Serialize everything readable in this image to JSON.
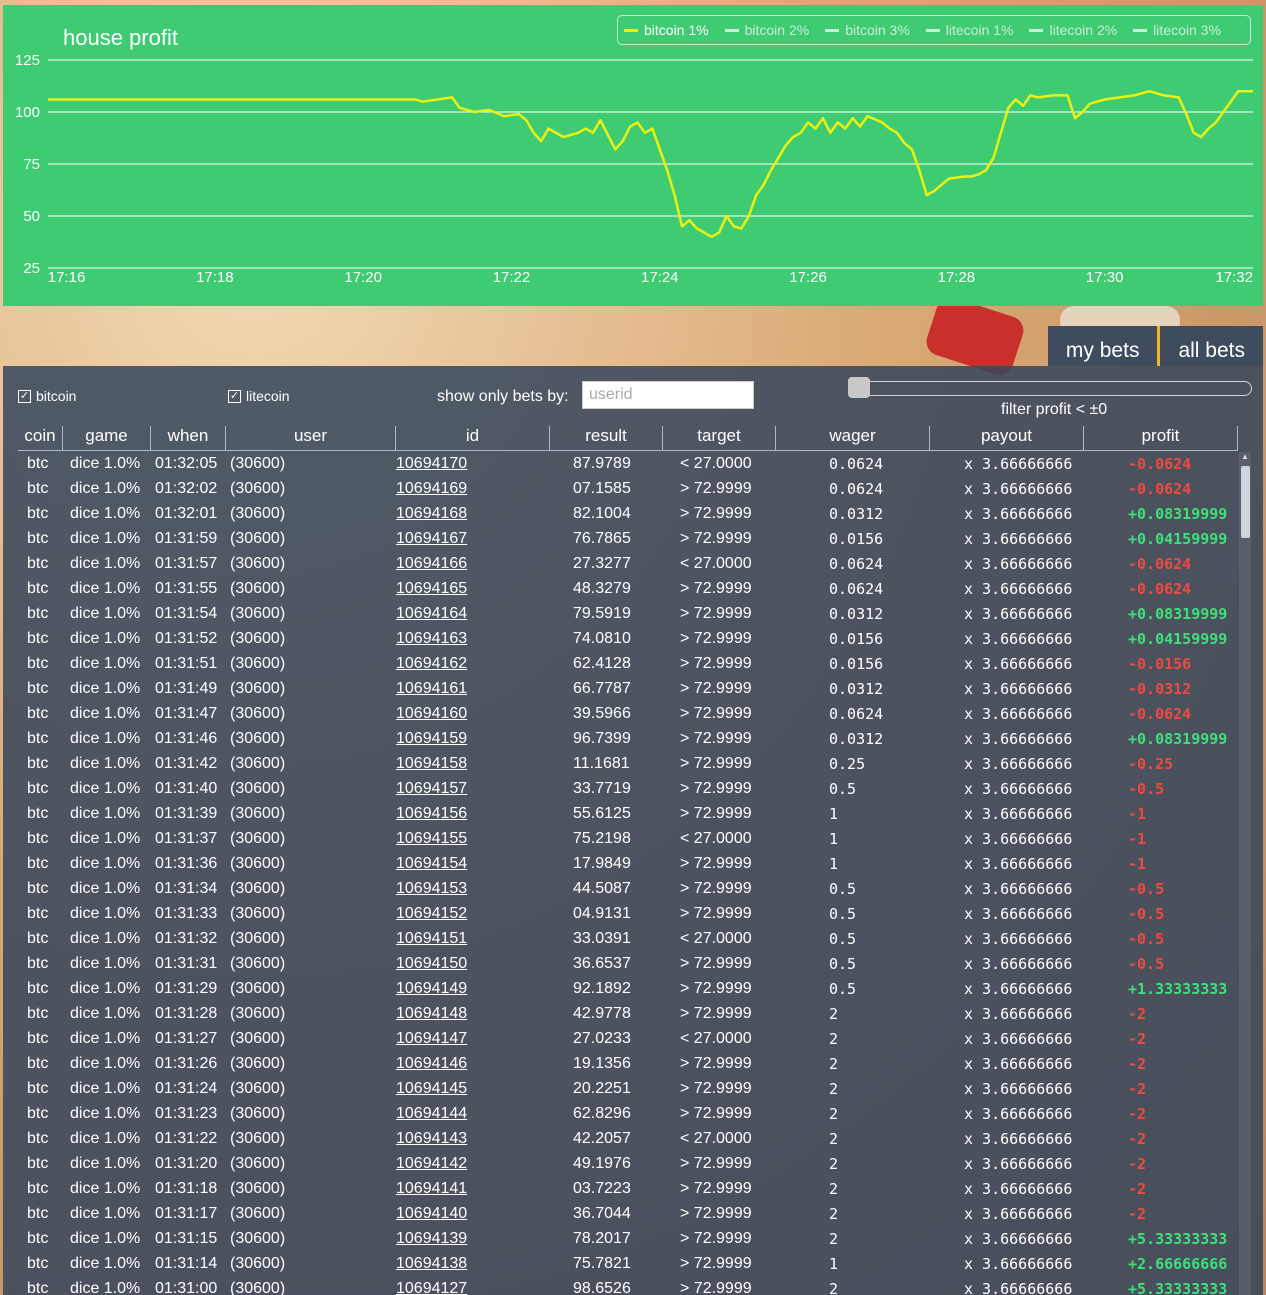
{
  "chart_data": {
    "type": "line",
    "title": "house profit",
    "legend": [
      "bitcoin 1%",
      "bitcoin 2%",
      "bitcoin 3%",
      "litecoin 1%",
      "litecoin 2%",
      "litecoin 3%"
    ],
    "legend_active": "bitcoin 1%",
    "legend_placement": "top-right",
    "grid": true,
    "ylim": [
      25,
      125
    ],
    "yticks": [
      25,
      50,
      75,
      100,
      125
    ],
    "xticks": [
      "17:16",
      "17:18",
      "17:20",
      "17:22",
      "17:24",
      "17:26",
      "17:28",
      "17:30",
      "17:32"
    ],
    "xlim_minutes": [
      15.75,
      32
    ],
    "colors": {
      "line": "#e8f213",
      "background": "#3fcb72"
    },
    "series": [
      {
        "name": "bitcoin 1%",
        "points": [
          [
            15.75,
            106
          ],
          [
            17,
            106
          ],
          [
            18,
            106
          ],
          [
            19,
            106
          ],
          [
            20,
            106
          ],
          [
            20.7,
            106
          ],
          [
            20.8,
            105
          ],
          [
            21,
            106
          ],
          [
            21.2,
            107
          ],
          [
            21.3,
            102
          ],
          [
            21.5,
            100
          ],
          [
            21.7,
            101
          ],
          [
            21.9,
            98
          ],
          [
            22.1,
            99
          ],
          [
            22.2,
            96
          ],
          [
            22.3,
            90
          ],
          [
            22.4,
            86
          ],
          [
            22.5,
            92
          ],
          [
            22.7,
            88
          ],
          [
            22.9,
            90
          ],
          [
            23,
            92
          ],
          [
            23.1,
            90
          ],
          [
            23.2,
            96
          ],
          [
            23.3,
            89
          ],
          [
            23.4,
            82
          ],
          [
            23.5,
            86
          ],
          [
            23.6,
            93
          ],
          [
            23.7,
            95
          ],
          [
            23.8,
            90
          ],
          [
            23.9,
            92
          ],
          [
            24,
            82
          ],
          [
            24.1,
            72
          ],
          [
            24.2,
            60
          ],
          [
            24.3,
            45
          ],
          [
            24.4,
            48
          ],
          [
            24.5,
            44
          ],
          [
            24.6,
            42
          ],
          [
            24.7,
            40
          ],
          [
            24.8,
            42
          ],
          [
            24.9,
            50
          ],
          [
            25,
            45
          ],
          [
            25.1,
            44
          ],
          [
            25.2,
            50
          ],
          [
            25.3,
            60
          ],
          [
            25.4,
            65
          ],
          [
            25.5,
            72
          ],
          [
            25.6,
            78
          ],
          [
            25.7,
            84
          ],
          [
            25.8,
            88
          ],
          [
            25.9,
            90
          ],
          [
            26,
            95
          ],
          [
            26.1,
            92
          ],
          [
            26.2,
            97
          ],
          [
            26.3,
            90
          ],
          [
            26.4,
            95
          ],
          [
            26.5,
            92
          ],
          [
            26.6,
            97
          ],
          [
            26.7,
            93
          ],
          [
            26.8,
            98
          ],
          [
            27,
            95
          ],
          [
            27.1,
            92
          ],
          [
            27.2,
            90
          ],
          [
            27.3,
            85
          ],
          [
            27.4,
            82
          ],
          [
            27.5,
            72
          ],
          [
            27.6,
            60
          ],
          [
            27.7,
            62
          ],
          [
            27.9,
            68
          ],
          [
            28.1,
            69
          ],
          [
            28.2,
            69
          ],
          [
            28.3,
            70
          ],
          [
            28.4,
            72
          ],
          [
            28.5,
            78
          ],
          [
            28.6,
            90
          ],
          [
            28.7,
            102
          ],
          [
            28.8,
            106
          ],
          [
            28.9,
            103
          ],
          [
            29,
            108
          ],
          [
            29.1,
            107
          ],
          [
            29.3,
            108
          ],
          [
            29.5,
            108
          ],
          [
            29.6,
            97
          ],
          [
            29.7,
            100
          ],
          [
            29.8,
            104
          ],
          [
            30,
            106
          ],
          [
            30.2,
            107
          ],
          [
            30.4,
            108
          ],
          [
            30.6,
            110
          ],
          [
            30.8,
            108
          ],
          [
            31,
            107
          ],
          [
            31.1,
            99
          ],
          [
            31.2,
            90
          ],
          [
            31.3,
            88
          ],
          [
            31.4,
            92
          ],
          [
            31.5,
            95
          ],
          [
            31.6,
            100
          ],
          [
            31.7,
            105
          ],
          [
            31.8,
            110
          ],
          [
            32,
            110
          ]
        ]
      }
    ]
  },
  "tabs": [
    {
      "label": "my bets"
    },
    {
      "label": "all bets"
    }
  ],
  "filters": {
    "bitcoin": {
      "label": "bitcoin",
      "checked": true
    },
    "litecoin": {
      "label": "litecoin",
      "checked": true
    },
    "show_only_label": "show only bets by:",
    "userid_placeholder": "userid",
    "profit_filter_label": "filter profit < ±0",
    "slider_value_fraction": 0
  },
  "table": {
    "columns": [
      "coin",
      "game",
      "when",
      "user",
      "id",
      "result",
      "target",
      "wager",
      "payout",
      "profit"
    ],
    "rows": [
      [
        "btc",
        "dice 1.0%",
        "01:32:05",
        "(30600)",
        "10694170",
        "87.9789",
        "red",
        "< 27.0000",
        "0.0624",
        "x 3.66666666",
        "-0.0624"
      ],
      [
        "btc",
        "dice 1.0%",
        "01:32:02",
        "(30600)",
        "10694169",
        "07.1585",
        "red",
        "> 72.9999",
        "0.0624",
        "x 3.66666666",
        "-0.0624"
      ],
      [
        "btc",
        "dice 1.0%",
        "01:32:01",
        "(30600)",
        "10694168",
        "82.1004",
        "green",
        "> 72.9999",
        "0.0312",
        "x 3.66666666",
        "+0.08319999"
      ],
      [
        "btc",
        "dice 1.0%",
        "01:31:59",
        "(30600)",
        "10694167",
        "76.7865",
        "green",
        "> 72.9999",
        "0.0156",
        "x 3.66666666",
        "+0.04159999"
      ],
      [
        "btc",
        "dice 1.0%",
        "01:31:57",
        "(30600)",
        "10694166",
        "27.3277",
        "gray",
        "< 27.0000",
        "0.0624",
        "x 3.66666666",
        "-0.0624"
      ],
      [
        "btc",
        "dice 1.0%",
        "01:31:55",
        "(30600)",
        "10694165",
        "48.3279",
        "gray",
        "> 72.9999",
        "0.0624",
        "x 3.66666666",
        "-0.0624"
      ],
      [
        "btc",
        "dice 1.0%",
        "01:31:54",
        "(30600)",
        "10694164",
        "79.5919",
        "green",
        "> 72.9999",
        "0.0312",
        "x 3.66666666",
        "+0.08319999"
      ],
      [
        "btc",
        "dice 1.0%",
        "01:31:52",
        "(30600)",
        "10694163",
        "74.0810",
        "green",
        "> 72.9999",
        "0.0156",
        "x 3.66666666",
        "+0.04159999"
      ],
      [
        "btc",
        "dice 1.0%",
        "01:31:51",
        "(30600)",
        "10694162",
        "62.4128",
        "gray",
        "> 72.9999",
        "0.0156",
        "x 3.66666666",
        "-0.0156"
      ],
      [
        "btc",
        "dice 1.0%",
        "01:31:49",
        "(30600)",
        "10694161",
        "66.7787",
        "gray",
        "> 72.9999",
        "0.0312",
        "x 3.66666666",
        "-0.0312"
      ],
      [
        "btc",
        "dice 1.0%",
        "01:31:47",
        "(30600)",
        "10694160",
        "39.5966",
        "gray",
        "> 72.9999",
        "0.0624",
        "x 3.66666666",
        "-0.0624"
      ],
      [
        "btc",
        "dice 1.0%",
        "01:31:46",
        "(30600)",
        "10694159",
        "96.7399",
        "green",
        "> 72.9999",
        "0.0312",
        "x 3.66666666",
        "+0.08319999"
      ],
      [
        "btc",
        "dice 1.0%",
        "01:31:42",
        "(30600)",
        "10694158",
        "11.1681",
        "red",
        "> 72.9999",
        "0.25",
        "x 3.66666666",
        "-0.25"
      ],
      [
        "btc",
        "dice 1.0%",
        "01:31:40",
        "(30600)",
        "10694157",
        "33.7719",
        "gray",
        "> 72.9999",
        "0.5",
        "x 3.66666666",
        "-0.5"
      ],
      [
        "btc",
        "dice 1.0%",
        "01:31:39",
        "(30600)",
        "10694156",
        "55.6125",
        "gray",
        "> 72.9999",
        "1",
        "x 3.66666666",
        "-1"
      ],
      [
        "btc",
        "dice 1.0%",
        "01:31:37",
        "(30600)",
        "10694155",
        "75.2198",
        "red",
        "< 27.0000",
        "1",
        "x 3.66666666",
        "-1"
      ],
      [
        "btc",
        "dice 1.0%",
        "01:31:36",
        "(30600)",
        "10694154",
        "17.9849",
        "red",
        "> 72.9999",
        "1",
        "x 3.66666666",
        "-1"
      ],
      [
        "btc",
        "dice 1.0%",
        "01:31:34",
        "(30600)",
        "10694153",
        "44.5087",
        "gray",
        "> 72.9999",
        "0.5",
        "x 3.66666666",
        "-0.5"
      ],
      [
        "btc",
        "dice 1.0%",
        "01:31:33",
        "(30600)",
        "10694152",
        "04.9131",
        "red",
        "> 72.9999",
        "0.5",
        "x 3.66666666",
        "-0.5"
      ],
      [
        "btc",
        "dice 1.0%",
        "01:31:32",
        "(30600)",
        "10694151",
        "33.0391",
        "gray",
        "< 27.0000",
        "0.5",
        "x 3.66666666",
        "-0.5"
      ],
      [
        "btc",
        "dice 1.0%",
        "01:31:31",
        "(30600)",
        "10694150",
        "36.6537",
        "gray",
        "> 72.9999",
        "0.5",
        "x 3.66666666",
        "-0.5"
      ],
      [
        "btc",
        "dice 1.0%",
        "01:31:29",
        "(30600)",
        "10694149",
        "92.1892",
        "green",
        "> 72.9999",
        "0.5",
        "x 3.66666666",
        "+1.33333333"
      ],
      [
        "btc",
        "dice 1.0%",
        "01:31:28",
        "(30600)",
        "10694148",
        "42.9778",
        "gray",
        "> 72.9999",
        "2",
        "x 3.66666666",
        "-2"
      ],
      [
        "btc",
        "dice 1.0%",
        "01:31:27",
        "(30600)",
        "10694147",
        "27.0233",
        "gray",
        "< 27.0000",
        "2",
        "x 3.66666666",
        "-2"
      ],
      [
        "btc",
        "dice 1.0%",
        "01:31:26",
        "(30600)",
        "10694146",
        "19.1356",
        "red",
        "> 72.9999",
        "2",
        "x 3.66666666",
        "-2"
      ],
      [
        "btc",
        "dice 1.0%",
        "01:31:24",
        "(30600)",
        "10694145",
        "20.2251",
        "red",
        "> 72.9999",
        "2",
        "x 3.66666666",
        "-2"
      ],
      [
        "btc",
        "dice 1.0%",
        "01:31:23",
        "(30600)",
        "10694144",
        "62.8296",
        "gray",
        "> 72.9999",
        "2",
        "x 3.66666666",
        "-2"
      ],
      [
        "btc",
        "dice 1.0%",
        "01:31:22",
        "(30600)",
        "10694143",
        "42.2057",
        "gray",
        "< 27.0000",
        "2",
        "x 3.66666666",
        "-2"
      ],
      [
        "btc",
        "dice 1.0%",
        "01:31:20",
        "(30600)",
        "10694142",
        "49.1976",
        "gray",
        "> 72.9999",
        "2",
        "x 3.66666666",
        "-2"
      ],
      [
        "btc",
        "dice 1.0%",
        "01:31:18",
        "(30600)",
        "10694141",
        "03.7223",
        "red",
        "> 72.9999",
        "2",
        "x 3.66666666",
        "-2"
      ],
      [
        "btc",
        "dice 1.0%",
        "01:31:17",
        "(30600)",
        "10694140",
        "36.7044",
        "gray",
        "> 72.9999",
        "2",
        "x 3.66666666",
        "-2"
      ],
      [
        "btc",
        "dice 1.0%",
        "01:31:15",
        "(30600)",
        "10694139",
        "78.2017",
        "green",
        "> 72.9999",
        "2",
        "x 3.66666666",
        "+5.33333333"
      ],
      [
        "btc",
        "dice 1.0%",
        "01:31:14",
        "(30600)",
        "10694138",
        "75.7821",
        "green",
        "> 72.9999",
        "1",
        "x 3.66666666",
        "+2.66666666"
      ],
      [
        "btc",
        "dice 1.0%",
        "01:31:00",
        "(30600)",
        "10694127",
        "98.6526",
        "green",
        "> 72.9999",
        "2",
        "x 3.66666666",
        "+5.33333333"
      ]
    ]
  }
}
